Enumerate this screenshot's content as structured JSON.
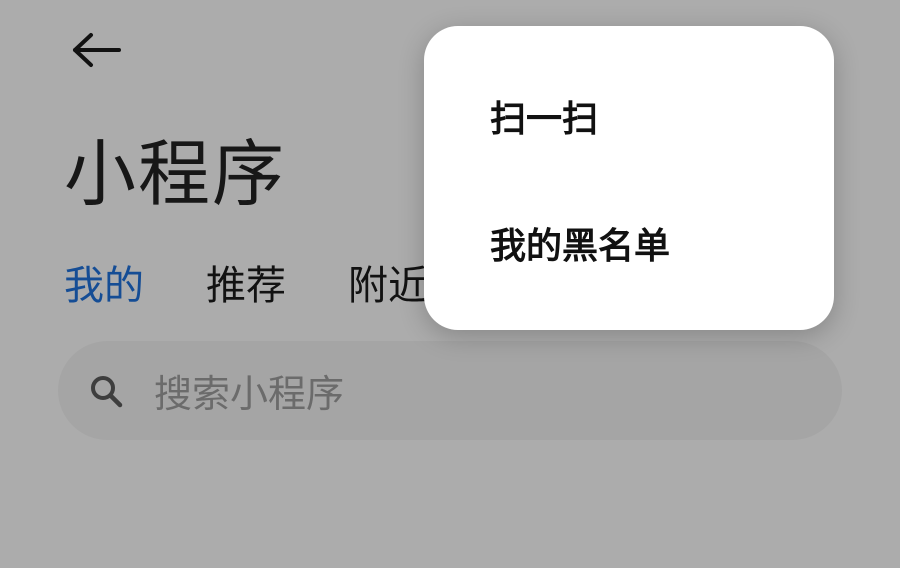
{
  "page": {
    "title": "小程序",
    "tabs": [
      {
        "label": "我的",
        "active": true
      },
      {
        "label": "推荐",
        "active": false
      },
      {
        "label": "附近",
        "active": false
      }
    ],
    "search": {
      "placeholder": "搜索小程序"
    }
  },
  "popup_menu": {
    "items": [
      {
        "label": "扫一扫"
      },
      {
        "label": "我的黑名单"
      }
    ]
  },
  "icons": {
    "back": "arrow-left-icon",
    "search": "search-icon"
  },
  "colors": {
    "accent": "#1f6fd6",
    "overlay": "rgba(0,0,0,0.30)",
    "popup_bg": "#ffffff"
  }
}
